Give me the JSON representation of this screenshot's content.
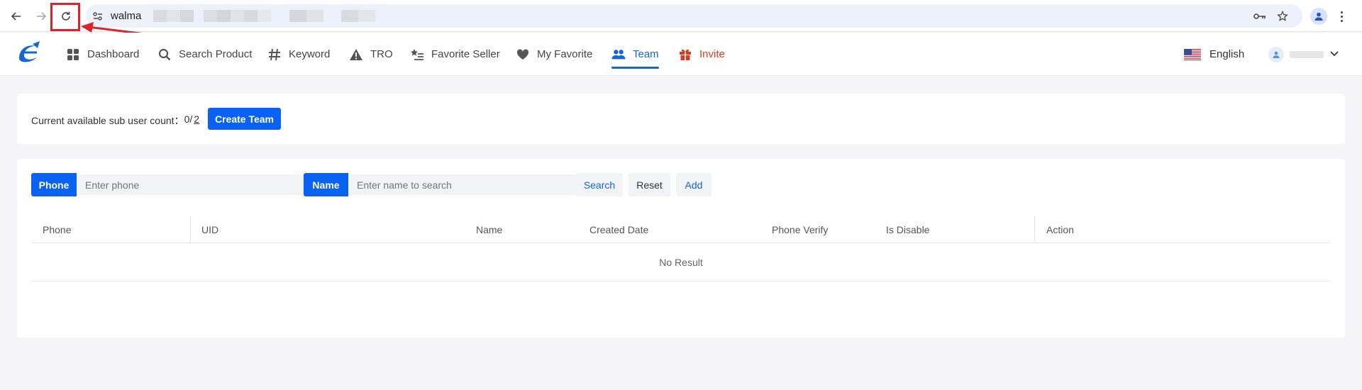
{
  "browser": {
    "url_text": "walma"
  },
  "nav": {
    "items": [
      {
        "label": "Dashboard"
      },
      {
        "label": "Search Product"
      },
      {
        "label": "Keyword"
      },
      {
        "label": "TRO"
      },
      {
        "label": "Favorite Seller"
      },
      {
        "label": "My Favorite"
      },
      {
        "label": "Team"
      },
      {
        "label": "Invite"
      }
    ],
    "active": "Team",
    "language": "English"
  },
  "team": {
    "count_label": "Current available sub user count：",
    "count_used": "0/",
    "count_total": "2",
    "create_button": "Create Team"
  },
  "filters": {
    "phone_label": "Phone",
    "phone_placeholder": "Enter phone",
    "name_label": "Name",
    "name_placeholder": "Enter name to search",
    "search_button": "Search",
    "reset_button": "Reset",
    "add_button": "Add"
  },
  "table": {
    "columns": [
      "Phone",
      "UID",
      "Name",
      "Created Date",
      "Phone Verify",
      "Is Disable",
      "Action"
    ],
    "empty_text": "No Result"
  },
  "colors": {
    "accent": "#0a62f2",
    "active_nav": "#1565d8",
    "invite": "#e03a1e",
    "highlight": "#e0202a"
  }
}
